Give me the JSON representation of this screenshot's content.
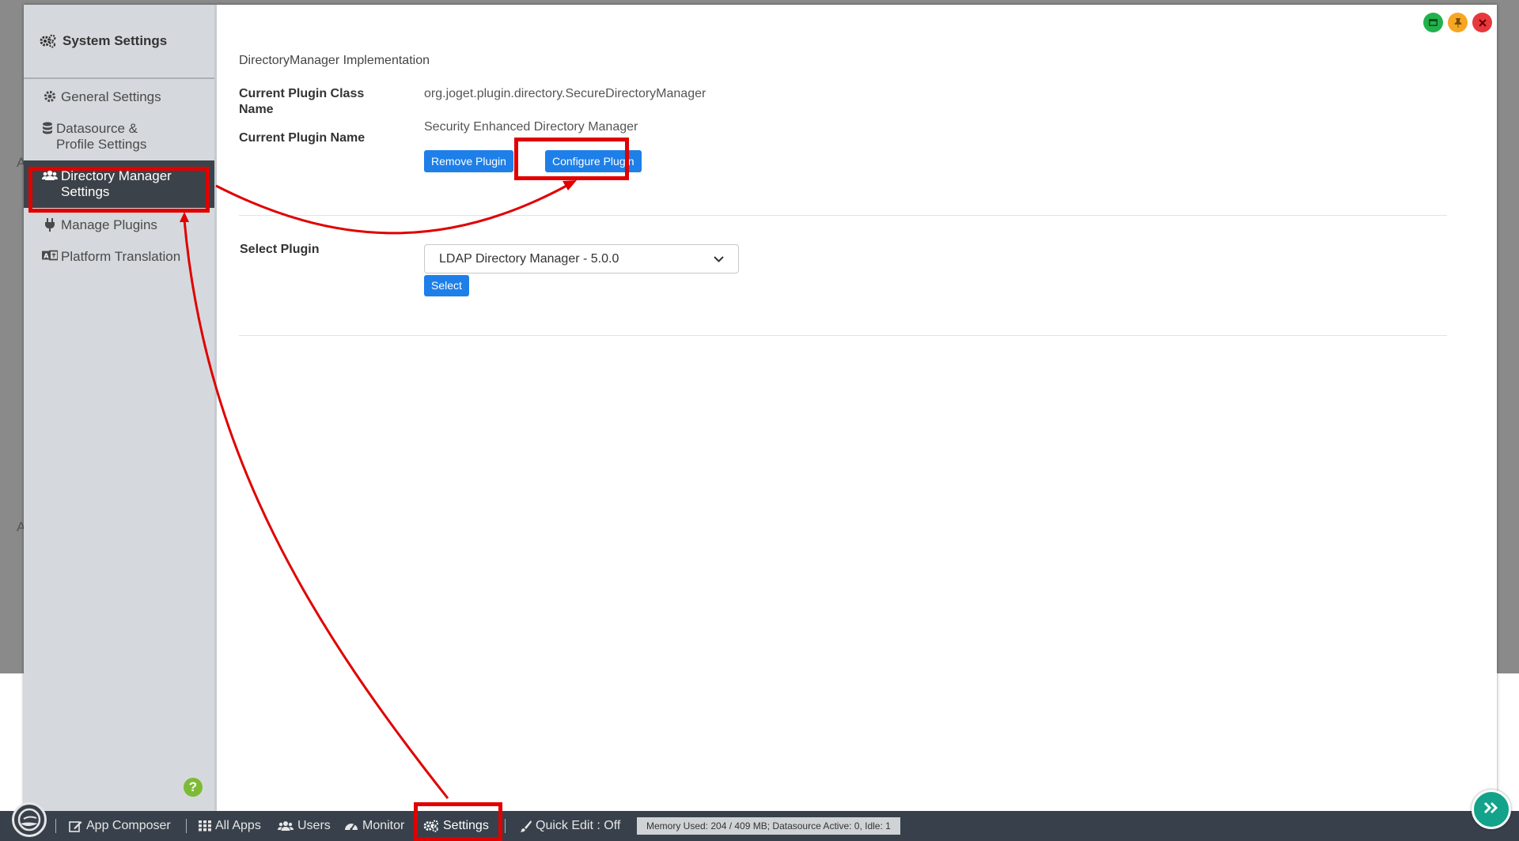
{
  "sidebar": {
    "title": "System Settings",
    "items": [
      {
        "label": "General Settings",
        "icon": "gear-icon"
      },
      {
        "label": "Datasource & Profile Settings",
        "icon": "database-icon"
      },
      {
        "label": "Directory Manager Settings",
        "icon": "users-icon",
        "active": true
      },
      {
        "label": "Manage Plugins",
        "icon": "plug-icon"
      },
      {
        "label": "Platform Translation",
        "icon": "language-icon"
      }
    ],
    "help_label": "?"
  },
  "content": {
    "section_title": "DirectoryManager Implementation",
    "class_label": "Current Plugin Class Name",
    "class_value": "org.joget.plugin.directory.SecureDirectoryManager",
    "name_label": "Current Plugin Name",
    "name_value": "Security Enhanced Directory Manager",
    "remove_button": "Remove Plugin",
    "configure_button": "Configure Plugin",
    "select_label": "Select Plugin",
    "select_value": "LDAP Directory Manager - 5.0.0",
    "select_button": "Select"
  },
  "window_controls": [
    {
      "name": "minimize-icon",
      "color": "#22b14c"
    },
    {
      "name": "pin-icon",
      "color": "#f5a623"
    },
    {
      "name": "close-icon",
      "color": "#e8383d"
    }
  ],
  "taskbar": {
    "items": [
      {
        "label": "App Composer",
        "icon": "edit-icon"
      },
      {
        "label": "All Apps",
        "icon": "grid-icon"
      },
      {
        "label": "Users",
        "icon": "users-icon"
      },
      {
        "label": "Monitor",
        "icon": "dashboard-icon"
      },
      {
        "label": "Settings",
        "icon": "gears-icon"
      },
      {
        "label": "Quick Edit : Off",
        "icon": "brush-icon"
      }
    ],
    "memory": "Memory Used: 204 / 409 MB; Datasource Active: 0, Idle: 1"
  },
  "colors": {
    "accent": "#1e7fe8",
    "annotation": "#e00000",
    "sidebar_active": "#3c4249",
    "taskbar": "#38414b"
  }
}
